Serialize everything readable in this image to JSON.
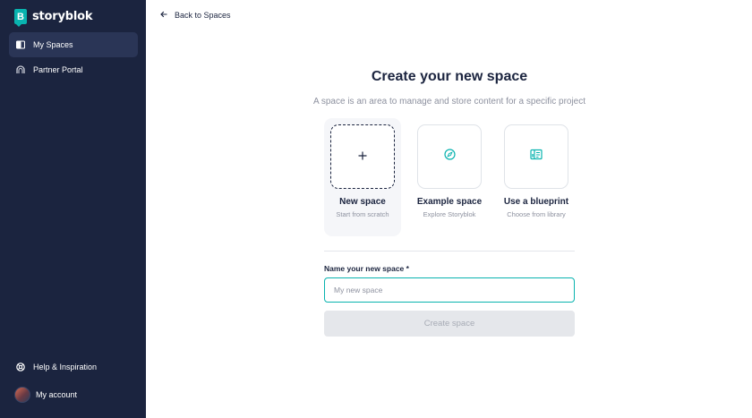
{
  "sidebar": {
    "logo_text": "storyblok",
    "logo_letter": "B",
    "items": [
      {
        "label": "My Spaces",
        "icon": "spaces-icon",
        "active": true
      },
      {
        "label": "Partner Portal",
        "icon": "partner-portal-icon",
        "active": false
      }
    ],
    "footer_items": [
      {
        "label": "Help & Inspiration",
        "icon": "help-icon"
      },
      {
        "label": "My account",
        "icon": "avatar"
      }
    ]
  },
  "header": {
    "back_label": "Back to Spaces"
  },
  "main": {
    "title": "Create your new space",
    "subtitle": "A space is an area to manage and store content for a specific project",
    "options": [
      {
        "title": "New space",
        "subtitle": "Start from scratch",
        "icon": "plus-icon",
        "selected": true
      },
      {
        "title": "Example space",
        "subtitle": "Explore Storyblok",
        "icon": "compass-icon",
        "selected": false
      },
      {
        "title": "Use a blueprint",
        "subtitle": "Choose from library",
        "icon": "blueprint-icon",
        "selected": false
      }
    ],
    "form": {
      "label": "Name your new space *",
      "placeholder": "My new space",
      "value": "",
      "submit_label": "Create space"
    }
  },
  "colors": {
    "sidebar_bg": "#1b243f",
    "accent": "#09b3af",
    "muted_text": "#8d919f",
    "disabled_button": "#e5e7eb"
  }
}
